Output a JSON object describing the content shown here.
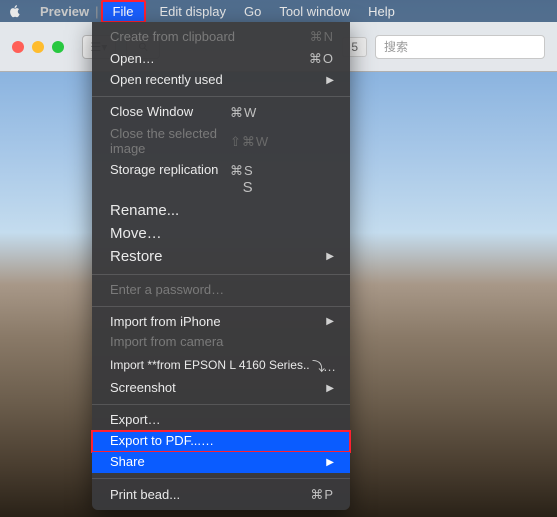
{
  "menubar": {
    "app_name": "Preview",
    "separator": "|",
    "items": {
      "file": "File",
      "edit_display": "Edit display",
      "go": "Go",
      "tool_window": "Tool window",
      "help": "Help"
    }
  },
  "window": {
    "badge": "5",
    "search_placeholder": "搜索",
    "sidebar_glyph": "☰▾",
    "zoom_glyph": "⚲"
  },
  "menu": {
    "create_from_clipboard": {
      "label": "Create from clipboard",
      "shortcut": "⌘N"
    },
    "open": {
      "label": "Open…",
      "shortcut": "⌘O"
    },
    "open_recent": {
      "label": "Open recently used",
      "submenu": "▶"
    },
    "close_window": {
      "label": "Close Win­dow",
      "shortcut": "⌘W"
    },
    "close_selected": {
      "label": "Close the selected image",
      "shortcut": "⇧⌘W"
    },
    "storage_replication": {
      "label": "Storage replica­tion",
      "shortcut_a": "⌘S",
      "shortcut_b": "S"
    },
    "rename": {
      "label": "Rename..."
    },
    "move": {
      "label": "Move…"
    },
    "restore": {
      "label": "Restore",
      "submenu": "▶"
    },
    "enter_password": {
      "label": "Enter a password…"
    },
    "import_iphone": {
      "label": "Import from iPhone",
      "submenu": "▶"
    },
    "import_camera": {
      "label": "Import from camera"
    },
    "import_epson": {
      "label": "Import **from EPSON L 4160 Series.."
    },
    "screenshot": {
      "label": "Screenshot",
      "submenu": "▶"
    },
    "export": {
      "label": "Export…"
    },
    "export_pdf": {
      "label": "Export to PDF...…"
    },
    "share": {
      "label": "Share",
      "submenu": "▶"
    },
    "print_bead": {
      "label": "Print bead...",
      "shortcut": "⌘P"
    }
  }
}
